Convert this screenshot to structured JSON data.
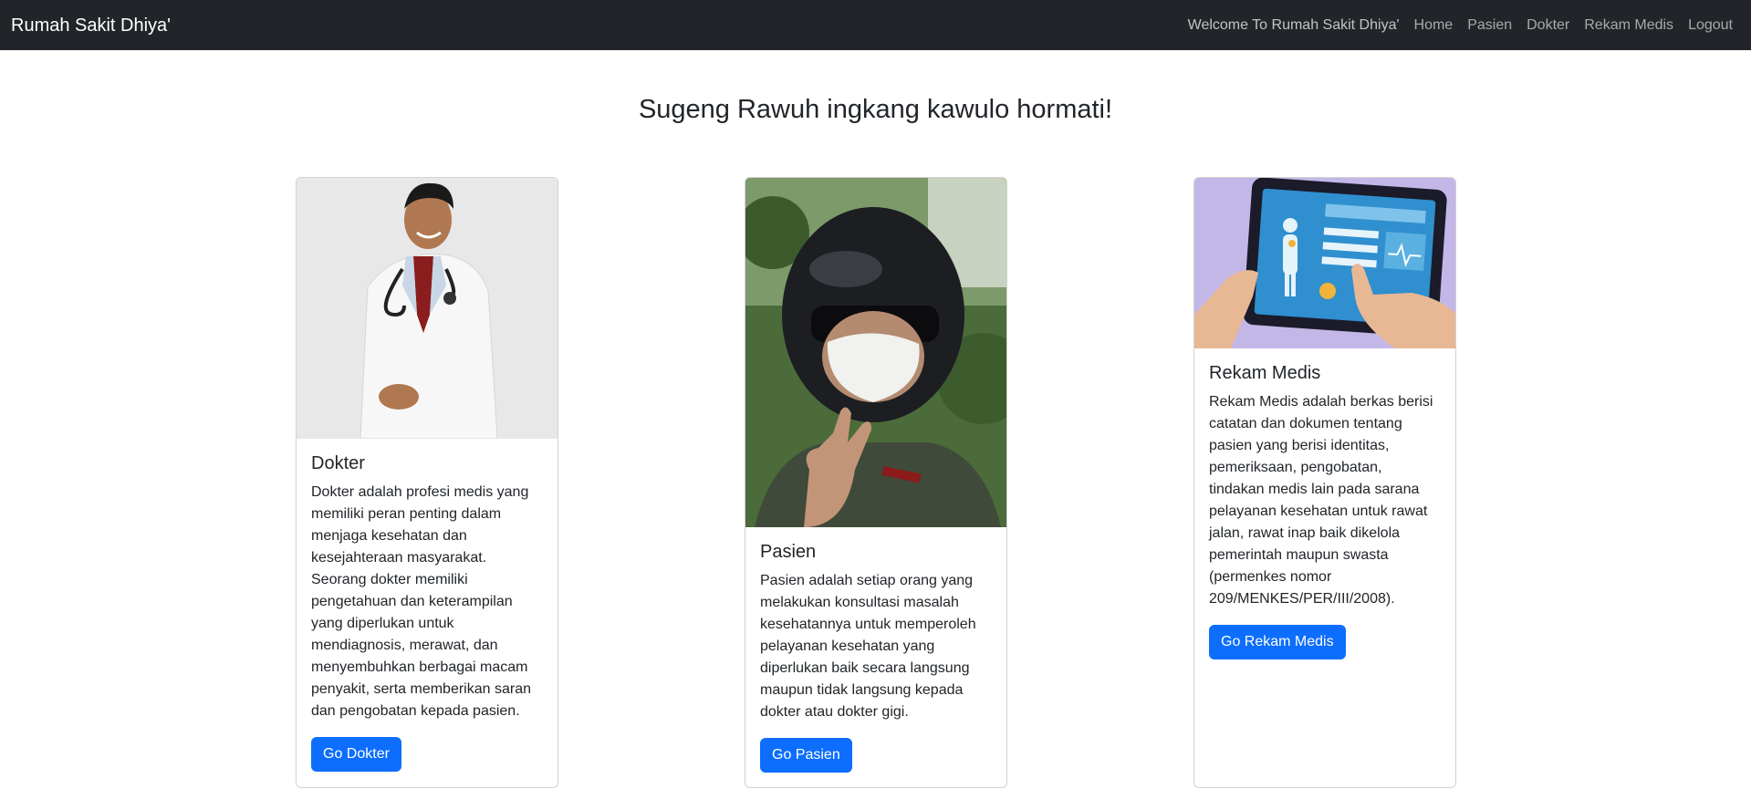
{
  "navbar": {
    "brand": "Rumah Sakit Dhiya'",
    "links": [
      {
        "label": "Welcome To Rumah Sakit Dhiya'"
      },
      {
        "label": "Home"
      },
      {
        "label": "Pasien"
      },
      {
        "label": "Dokter"
      },
      {
        "label": "Rekam Medis"
      },
      {
        "label": "Logout"
      }
    ]
  },
  "headline": "Sugeng Rawuh ingkang kawulo hormati!",
  "cards": [
    {
      "image": "doctor-photo",
      "title": "Dokter",
      "text": "Dokter adalah profesi medis yang memiliki peran penting dalam menjaga kesehatan dan kesejahteraan masyarakat. Seorang dokter memiliki pengetahuan dan keterampilan yang diperlukan untuk mendiagnosis, merawat, dan menyembuhkan berbagai macam penyakit, serta memberikan saran dan pengobatan kepada pasien.",
      "button": "Go Dokter"
    },
    {
      "image": "patient-photo",
      "title": "Pasien",
      "text": "Pasien adalah setiap orang yang melakukan konsultasi masalah kesehatannya untuk memperoleh pelayanan kesehatan yang diperlukan baik secara langsung maupun tidak langsung kepada dokter atau dokter gigi.",
      "button": "Go Pasien"
    },
    {
      "image": "tablet-illustration",
      "title": "Rekam Medis",
      "text": "Rekam Medis adalah berkas berisi catatan dan dokumen tentang pasien yang berisi identitas, pemeriksaan, pengobatan, tindakan medis lain pada sarana pelayanan kesehatan untuk rawat jalan, rawat inap baik dikelola pemerintah maupun swasta (permenkes nomor 209/MENKES/PER/III/2008).",
      "button": "Go Rekam Medis"
    }
  ],
  "colors": {
    "navbar_bg": "#212529",
    "primary": "#0d6efd"
  }
}
